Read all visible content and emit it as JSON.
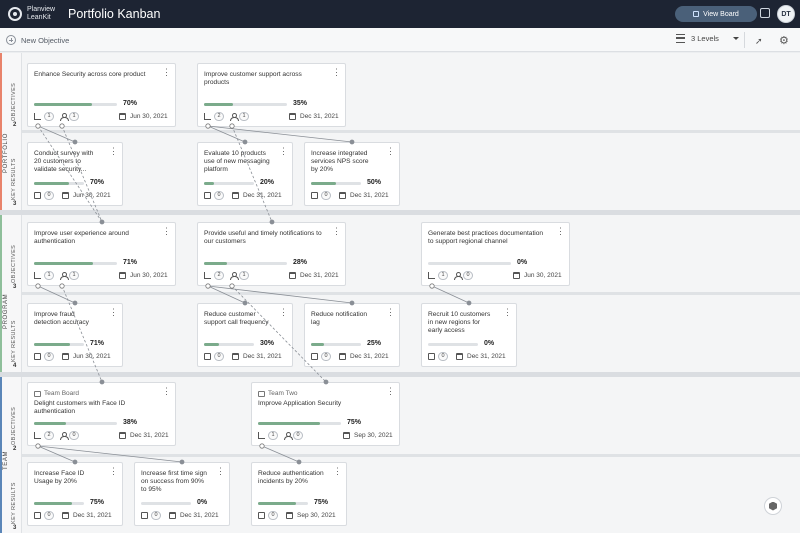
{
  "header": {
    "logo_line1": "Planview",
    "logo_line2": "LeanKit",
    "title": "Portfolio Kanban",
    "view_board_label": "View Board",
    "avatar_initials": "DT"
  },
  "toolbar": {
    "new_objective_label": "New Objective",
    "levels_label": "3 Levels"
  },
  "lanes": {
    "portfolio": {
      "label": "PORTFOLIO",
      "color": "#e8836b",
      "objectives_label": "OBJECTIVES",
      "objectives_count": "2",
      "key_results_label": "KEY RESULTS",
      "key_results_count": "3"
    },
    "program": {
      "label": "PROGRAM",
      "color": "#8fbf9b",
      "objectives_label": "OBJECTIVES",
      "objectives_count": "3",
      "key_results_label": "KEY RESULTS",
      "key_results_count": "4"
    },
    "team": {
      "label": "TEAM",
      "color": "#5b86b8",
      "objectives_label": "OBJECTIVES",
      "objectives_count": "2",
      "key_results_label": "KEY RESULTS",
      "key_results_count": "3"
    }
  },
  "cards": {
    "c1": {
      "title": "Enhance Security across core product",
      "pct": "70%",
      "progress": 0.7,
      "a": "1",
      "b": "1",
      "date": "Jun 30, 2021"
    },
    "c2": {
      "title": "Improve customer support across products",
      "pct": "35%",
      "progress": 0.35,
      "a": "2",
      "b": "1",
      "date": "Dec 31, 2021"
    },
    "c3": {
      "title": "Conduct survey with 20 customers to validate security...",
      "pct": "70%",
      "progress": 0.7,
      "a": "0",
      "date": "Jun 30, 2021"
    },
    "c4": {
      "title": "Evaluate 10 products use of new messaging platform",
      "pct": "20%",
      "progress": 0.2,
      "a": "0",
      "date": "Dec 31, 2021"
    },
    "c5": {
      "title": "Increase integrated services NPS score by 20%",
      "pct": "50%",
      "progress": 0.5,
      "a": "0",
      "date": "Dec 31, 2021"
    },
    "c6": {
      "title": "Improve user experience around authentication",
      "pct": "71%",
      "progress": 0.71,
      "a": "1",
      "b": "1",
      "date": "Jun 30, 2021"
    },
    "c7": {
      "title": "Provide useful and timely notifications to our customers",
      "pct": "28%",
      "progress": 0.28,
      "a": "2",
      "b": "1",
      "date": "Dec 31, 2021"
    },
    "c8": {
      "title": "Generate best practices documentation to support regional channel",
      "pct": "0%",
      "progress": 0,
      "a": "1",
      "b": "0",
      "date": "Jun 30, 2021"
    },
    "c9": {
      "title": "Improve fraud detection accuracy",
      "pct": "71%",
      "progress": 0.71,
      "a": "0",
      "date": "Jun 30, 2021"
    },
    "c10": {
      "title": "Reduce customer support call frequency",
      "pct": "30%",
      "progress": 0.3,
      "a": "0",
      "date": "Dec 31, 2021"
    },
    "c11": {
      "title": "Reduce notification lag",
      "pct": "25%",
      "progress": 0.25,
      "a": "0",
      "date": "Dec 31, 2021"
    },
    "c12": {
      "title": "Recruit 10 customers in new regions for early access",
      "pct": "0%",
      "progress": 0,
      "a": "0",
      "date": "Dec 31, 2021"
    },
    "c13": {
      "board": "Team Board",
      "title": "Delight customers with Face ID authentication",
      "pct": "38%",
      "progress": 0.38,
      "a": "2",
      "b": "0",
      "date": "Dec 31, 2021"
    },
    "c14": {
      "board": "Team Two",
      "title": "Improve Application Security",
      "pct": "75%",
      "progress": 0.75,
      "a": "1",
      "b": "0",
      "date": "Sep 30, 2021"
    },
    "c15": {
      "title": "Increase Face ID Usage by 20%",
      "pct": "75%",
      "progress": 0.75,
      "a": "0",
      "date": "Dec 31, 2021"
    },
    "c16": {
      "title": "Increase first time sign on success from 90% to 95%",
      "pct": "0%",
      "progress": 0,
      "a": "0",
      "date": "Dec 31, 2021"
    },
    "c17": {
      "title": "Reduce authentication incidents by 20%",
      "pct": "75%",
      "progress": 0.75,
      "a": "0",
      "date": "Sep 30, 2021"
    }
  },
  "colors": {
    "progress_fill": "#7bab8b",
    "header_bg": "#1d2433"
  }
}
